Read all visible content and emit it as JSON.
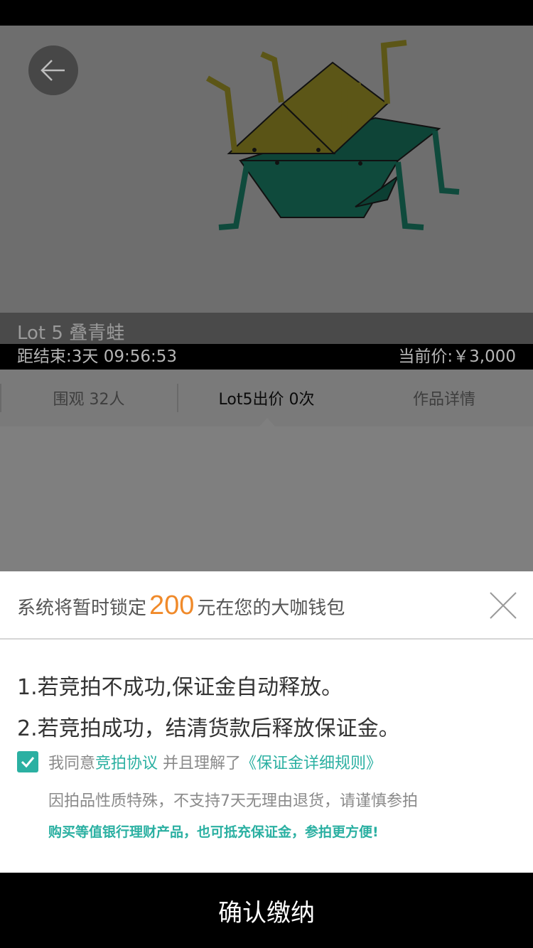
{
  "hero": {
    "image": "origami-frog-artwork",
    "lot_title": "Lot 5 叠青蛙",
    "countdown": "距结束:3天 09:56:53",
    "current_price": "当前价:￥3,000"
  },
  "tabs": [
    {
      "label": "围观 32人",
      "active": false
    },
    {
      "label": "Lot5出价 0次",
      "active": true
    },
    {
      "label": "作品详情",
      "active": false
    }
  ],
  "sheet": {
    "lock_prefix": "系统将暂时锁定",
    "lock_amount": "200",
    "lock_suffix": "元在您的大咖钱包",
    "rules": [
      "1.若竞拍不成功,保证金自动释放。",
      "2.若竞拍成功，结清货款后释放保证金。"
    ],
    "agree_prefix": "我同意",
    "agree_link": "竞拍协议",
    "agree_middle": " 并且理解了",
    "rules_link": "《保证金详细规则》",
    "no_return_note": "因拍品性质特殊，不支持7天无理由退货，请谨慎参拍",
    "finance_note": "购买等值银行理财产品，也可抵充保证金，参拍更方便!",
    "agree_checked": true
  },
  "confirm_label": "确认缴纳",
  "colors": {
    "accent": "#2bb0a2",
    "amount": "#f08a2a"
  }
}
